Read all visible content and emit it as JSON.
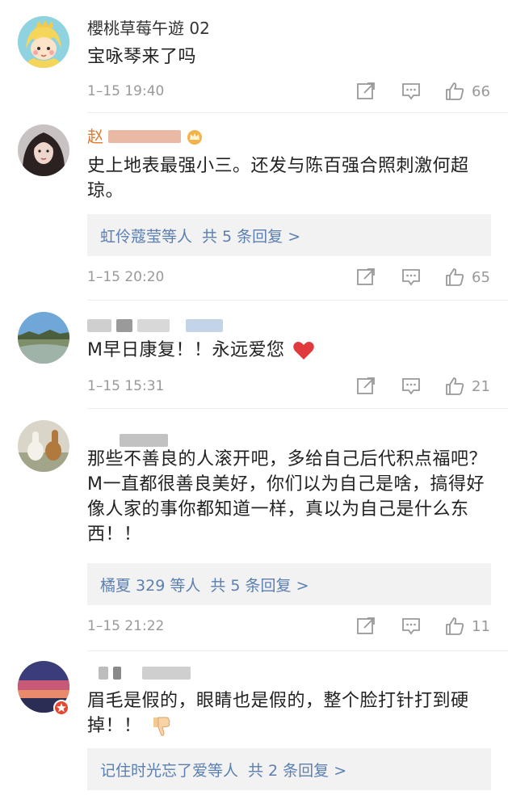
{
  "comments": [
    {
      "name": "櫻桃草莓午遊 02",
      "text": "宝咏琴来了吗",
      "time": "1–15 19:40",
      "likes": "66",
      "replies": null
    },
    {
      "name": "赵",
      "text": "史上地表最强小三。还发与陈百强合照刺激何超琼。",
      "time": "1–15 20:20",
      "likes": "65",
      "replies": {
        "names": "虹伶蔻莹等人",
        "count": "共 5 条回复 >"
      }
    },
    {
      "name": "",
      "text": "M早日康复！！永远爱您",
      "time": "1–15 15:31",
      "likes": "21",
      "replies": null
    },
    {
      "name": "",
      "text": "那些不善良的人滚开吧，多给自己后代积点福吧？M一直都很善良美好，你们以为自己是啥，搞得好像人家的事你都知道一样，真以为自己是什么东西！！",
      "time": "1–15 21:22",
      "likes": "11",
      "replies": {
        "names": "橘夏 329 等人",
        "count": "共 5 条回复 >"
      }
    },
    {
      "name": "",
      "text": "眉毛是假的，眼睛也是假的，整个脸打针打到硬掉！！",
      "time": "",
      "likes": "",
      "replies": {
        "names": "记住时光忘了爱等人",
        "count": "共 2 条回复 >"
      }
    }
  ],
  "colors": {
    "link": "#5b7fb0",
    "meta": "#999999",
    "reply_bg": "#f2f2f2",
    "heart": "#e0393e"
  },
  "icons": [
    "share-icon",
    "comment-icon",
    "like-icon",
    "heart-emoji",
    "thumbs-down-emoji",
    "crown-badge-icon"
  ]
}
